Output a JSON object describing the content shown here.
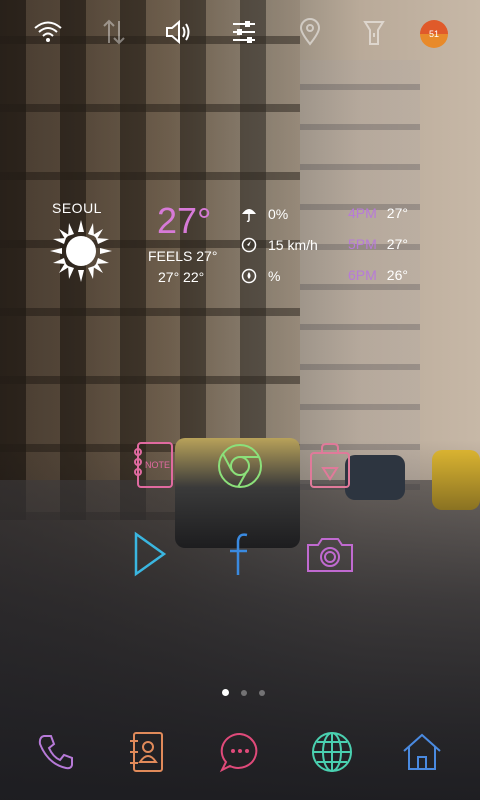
{
  "status_bar": {
    "icons": [
      "wifi-icon",
      "data-arrows-icon",
      "sound-icon",
      "settings-sliders-icon",
      "location-icon",
      "flashlight-icon"
    ],
    "battery_level": "51"
  },
  "weather": {
    "city": "SEOUL",
    "temperature": "27°",
    "feels_like": "FEELS 27°",
    "high_low": "27° 22°",
    "precipitation": "0%",
    "wind": "15 km/h",
    "humidity": "%",
    "forecast": [
      {
        "time": "4PM",
        "temp": "27°"
      },
      {
        "time": "5PM",
        "temp": "27°"
      },
      {
        "time": "6PM",
        "temp": "26°"
      }
    ]
  },
  "apps": [
    {
      "name": "note-app",
      "label": "NOTE"
    },
    {
      "name": "chrome-app"
    },
    {
      "name": "store-app"
    },
    {
      "name": "play-app"
    },
    {
      "name": "facebook-app"
    },
    {
      "name": "camera-app"
    }
  ],
  "dock": [
    "phone-icon",
    "contacts-icon",
    "messages-icon",
    "browser-icon",
    "home-icon"
  ],
  "page_indicator": {
    "pages": 3,
    "current": 1
  },
  "colors": {
    "accent_pink": "#d77ad8",
    "accent_purple": "#b77ad8"
  }
}
